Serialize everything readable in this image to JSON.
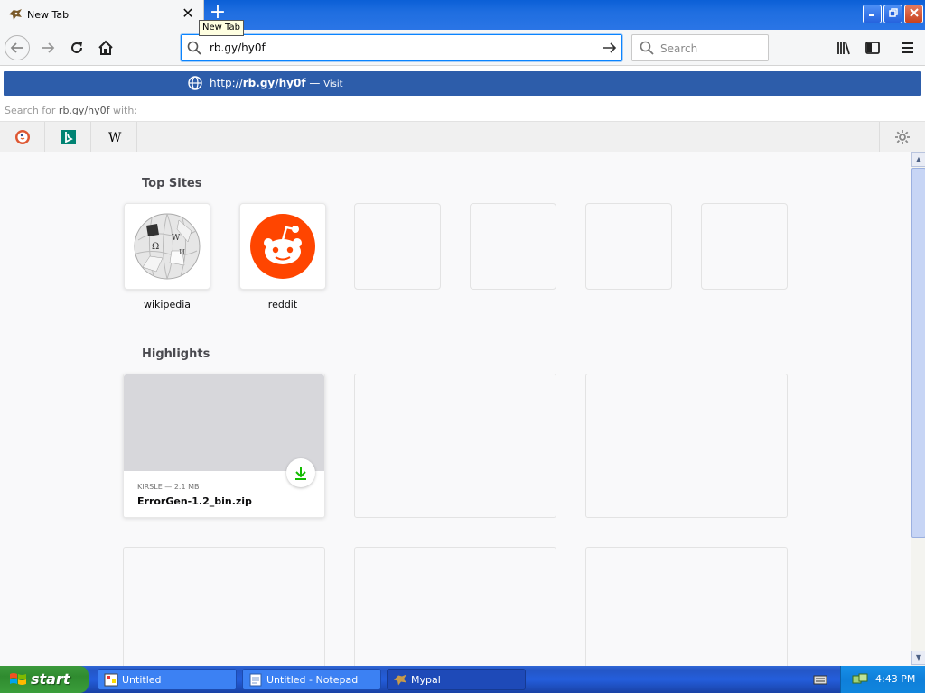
{
  "window": {
    "tab_title": "New Tab",
    "tooltip": "New Tab"
  },
  "navbar": {
    "url_value": "rb.gy/hy0f",
    "search_placeholder": "Search"
  },
  "dropdown": {
    "suggestion_prefix": "http://",
    "suggestion_domain": "rb.gy/hy0f",
    "suggestion_sep": " — ",
    "suggestion_action": "Visit",
    "search_for_prefix": "Search for ",
    "search_for_query": "rb.gy/hy0f",
    "search_for_suffix": " with:",
    "engines": [
      "duckduckgo-icon",
      "bing-icon",
      "wikipedia-icon"
    ]
  },
  "newtab": {
    "top_sites_title": "Top Sites",
    "top_sites": [
      {
        "label": "wikipedia",
        "icon": "wikipedia-icon"
      },
      {
        "label": "reddit",
        "icon": "reddit-icon"
      }
    ],
    "highlights_title": "Highlights",
    "highlights": [
      {
        "meta": "KIRSLE — 2.1 MB",
        "name": "ErrorGen-1.2_bin.zip",
        "icon": "download-icon"
      }
    ]
  },
  "taskbar": {
    "start_label": "start",
    "tasks": [
      {
        "label": "Untitled"
      },
      {
        "label": "Untitled - Notepad"
      },
      {
        "label": "Mypal"
      }
    ],
    "clock": "4:43 PM"
  },
  "colors": {
    "accent": "#0a84ff",
    "suggestion_bg": "#2d5daa",
    "reddit": "#ff4500",
    "download_green": "#12bc00"
  }
}
